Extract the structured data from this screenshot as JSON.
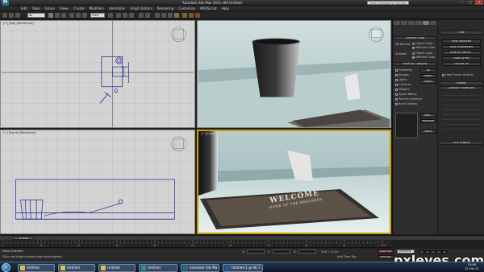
{
  "titlebar": {
    "title": "Autodesk 3ds Max 2011 x64    Untitled",
    "search_placeholder": "Type a keyword or phrase",
    "min_glyph": "–",
    "max_glyph": "□",
    "close_glyph": "✕"
  },
  "menu": [
    "Edit",
    "Tools",
    "Group",
    "Views",
    "Create",
    "Modifiers",
    "Animation",
    "Graph Editors",
    "Rendering",
    "Customize",
    "MAXScript",
    "Help"
  ],
  "toolbar": {
    "selection_filter": "All",
    "ref_coord": "View"
  },
  "viewports": {
    "top_label": "[+] [Top] [Wireframe]",
    "front_label": "[+] [Front] [Wireframe]",
    "left_label": "[+] [Perspective] [Smooth + Highlights]",
    "persp_label": "[+] [Camera01] [Smooth + Highlights + Edged Faces]"
  },
  "mat": {
    "line1": "WELCOME",
    "line2": "HOME OF THE BROCKERS"
  },
  "command_panel": {
    "display_color": "Display Color",
    "wireframe_label": "Wireframe:",
    "shaded_label": "Shaded:",
    "object_color": "Object Color",
    "material_color": "Material Color",
    "hide_by_category": "Hide by Category",
    "categories": [
      "Geometry",
      "Shapes",
      "Lights",
      "Cameras",
      "Helpers",
      "Space Warps",
      "Particle Systems",
      "Bone Objects"
    ],
    "btn_all": "All",
    "btn_none": "None",
    "btn_invert": "Invert",
    "btn_add": "Add...",
    "btn_remove": "Remove",
    "btn_none2": "None",
    "hide": "Hide",
    "hide_selected": "Hide Selected",
    "hide_unselected": "Hide Unselected",
    "hide_by_name": "Hide by Name...",
    "hide_by_hit": "Hide by Hit",
    "unhide_all": "Unhide All",
    "hide_frozen": "Hide Frozen Objects",
    "freeze": "Freeze",
    "display_properties": "Display Properties",
    "link_display": "Link Display"
  },
  "timeline": {
    "slider": "0 / 100",
    "ticks": [
      "0",
      "10",
      "20",
      "30",
      "40",
      "50",
      "60",
      "70",
      "80",
      "90",
      "100"
    ]
  },
  "status": {
    "selection": "None Selected",
    "prompt": "Click and drag to select and move objects",
    "x": "X:",
    "y": "Y:",
    "z": "Z:",
    "grid": "Grid = 0.1m",
    "auto_key": "Auto Key",
    "set_key": "Set Key",
    "selected": "Selected",
    "add_time_tag": "Add Time Tag"
  },
  "taskbar": {
    "buttons": [
      {
        "label": "Untitled",
        "color": "#e0c040"
      },
      {
        "label": "Untitled",
        "color": "#e0c040"
      },
      {
        "label": "Untitled",
        "color": "#e0c040"
      },
      {
        "label": "Untitled",
        "color": "#3a8a9a"
      },
      {
        "label": "Autodesk 3ds Ma...",
        "color": "#2a6a8a"
      },
      {
        "label": "Untitled-1 @ 66.7...",
        "color": "#1c5aa0"
      }
    ],
    "time": "15:48",
    "date": "22-Oct-11"
  },
  "watermark": "pxleyes.com",
  "colors": {
    "active_viewport_border": "#c8a000",
    "viewport_bg_ortho": "#d3d3d3",
    "scene_wall": "#c7d5d5"
  }
}
